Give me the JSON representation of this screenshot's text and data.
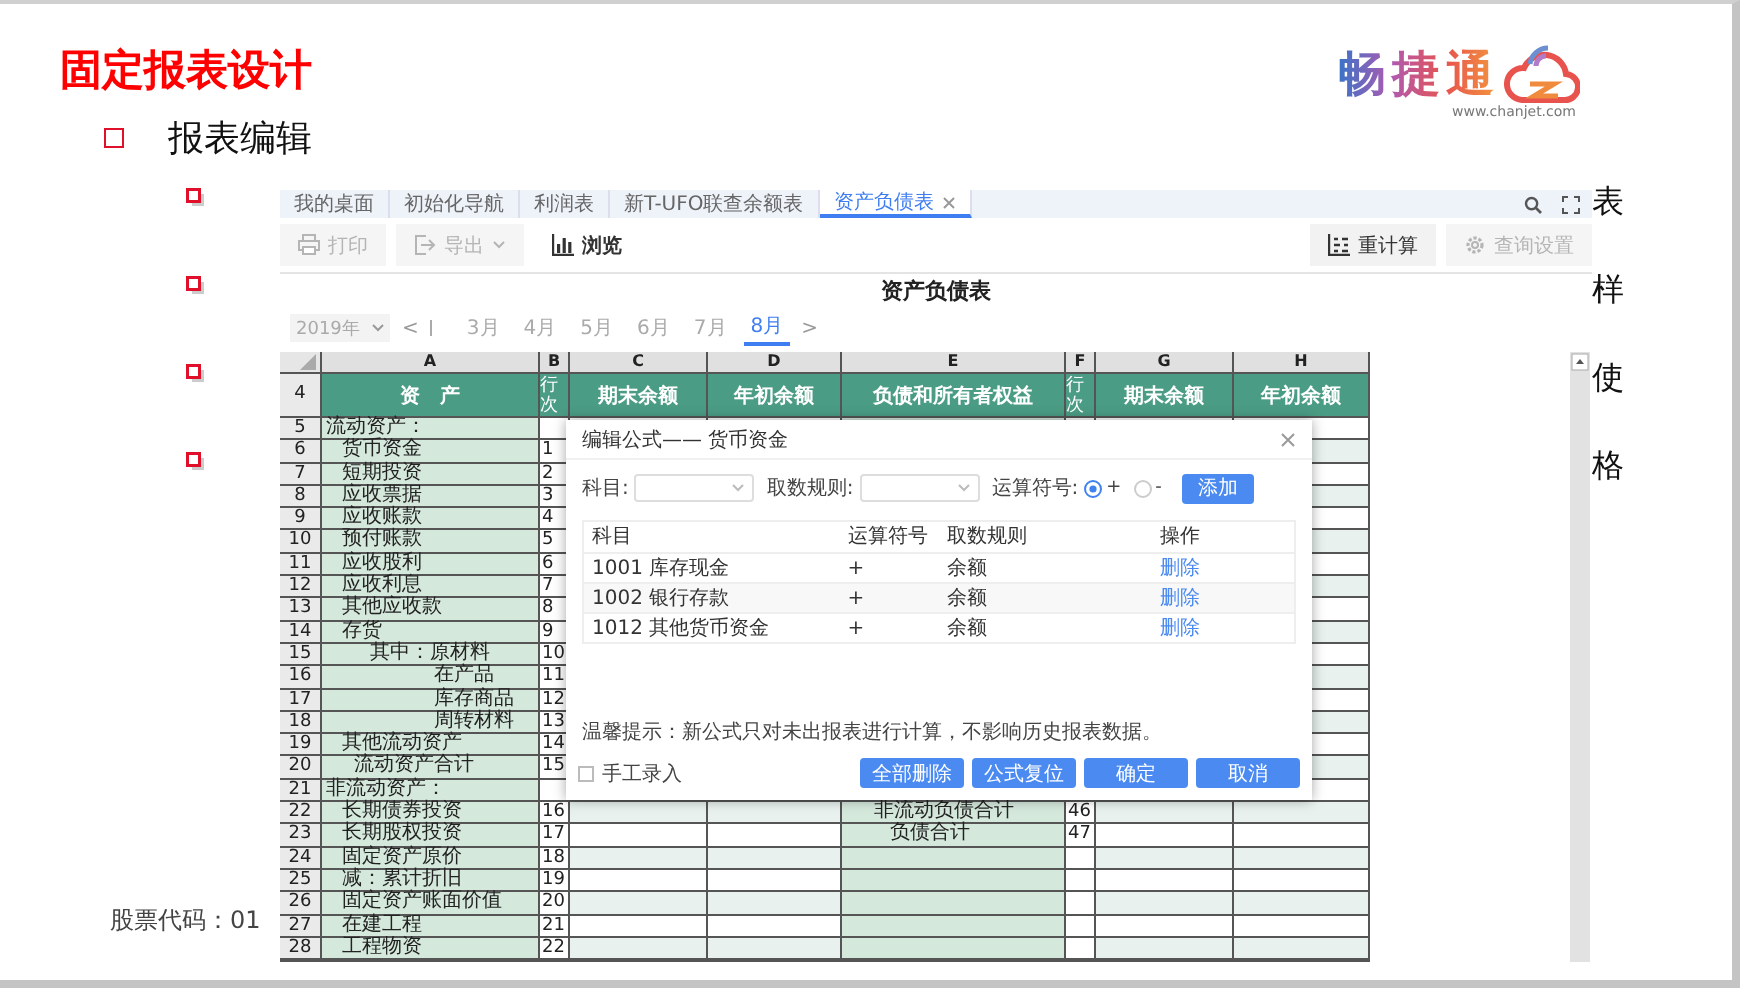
{
  "slide": {
    "title": "固定报表设计",
    "bullet": "报表编辑",
    "logo": {
      "name": "畅捷通",
      "url": "www.chanjet.com"
    },
    "side_fragments": [
      "表",
      "样",
      "使",
      "格"
    ],
    "footer": "股票代码：01"
  },
  "app": {
    "tabs": [
      {
        "label": "我的桌面",
        "selected": false
      },
      {
        "label": "初始化导航",
        "selected": false
      },
      {
        "label": "利润表",
        "selected": false
      },
      {
        "label": "新T-UFO联查余额表",
        "selected": false
      },
      {
        "label": "资产负债表",
        "selected": true
      }
    ],
    "toolbar_left": [
      {
        "label": "打印",
        "disabled": true
      },
      {
        "label": "导出",
        "disabled": true
      },
      {
        "label": "浏览",
        "disabled": false
      }
    ],
    "toolbar_right": [
      {
        "label": "重计算",
        "disabled": false
      },
      {
        "label": "查询设置",
        "disabled": true
      }
    ],
    "report_title": "资产负债表",
    "year": "2019年",
    "prev": "<",
    "next": ">",
    "months": [
      {
        "label": "3月",
        "selected": false
      },
      {
        "label": "4月",
        "selected": false
      },
      {
        "label": "5月",
        "selected": false
      },
      {
        "label": "6月",
        "selected": false
      },
      {
        "label": "7月",
        "selected": false
      },
      {
        "label": "8月",
        "selected": true
      }
    ],
    "sheet": {
      "columns": [
        "A",
        "B",
        "C",
        "D",
        "E",
        "F",
        "G",
        "H"
      ],
      "header": {
        "num": "4",
        "cells": [
          "资　产",
          "行次",
          "期末余额",
          "年初余额",
          "负债和所有者权益",
          "行次",
          "期末余额",
          "年初余额"
        ]
      },
      "rows": [
        {
          "num": "5",
          "asset": {
            "text": "流动资产：",
            "kind": "section"
          }
        },
        {
          "num": "6",
          "asset": {
            "text": "货币资金",
            "kind": "item"
          },
          "line": "1"
        },
        {
          "num": "7",
          "asset": {
            "text": "短期投资",
            "kind": "item"
          },
          "line": "2"
        },
        {
          "num": "8",
          "asset": {
            "text": "应收票据",
            "kind": "item"
          },
          "line": "3"
        },
        {
          "num": "9",
          "asset": {
            "text": "应收账款",
            "kind": "item"
          },
          "line": "4"
        },
        {
          "num": "10",
          "asset": {
            "text": "预付账款",
            "kind": "item"
          },
          "line": "5"
        },
        {
          "num": "11",
          "asset": {
            "text": "应收股利",
            "kind": "item"
          },
          "line": "6"
        },
        {
          "num": "12",
          "asset": {
            "text": "应收利息",
            "kind": "item"
          },
          "line": "7"
        },
        {
          "num": "13",
          "asset": {
            "text": "其他应收款",
            "kind": "item"
          },
          "line": "8"
        },
        {
          "num": "14",
          "asset": {
            "text": "存货",
            "kind": "item"
          },
          "line": "9"
        },
        {
          "num": "15",
          "asset": {
            "text": "其中：原材料",
            "kind": "sub"
          },
          "line": "10"
        },
        {
          "num": "16",
          "asset": {
            "text": "在产品",
            "kind": "detail"
          },
          "line": "11"
        },
        {
          "num": "17",
          "asset": {
            "text": "库存商品",
            "kind": "detail"
          },
          "line": "12"
        },
        {
          "num": "18",
          "asset": {
            "text": "周转材料",
            "kind": "detail"
          },
          "line": "13"
        },
        {
          "num": "19",
          "asset": {
            "text": "其他流动资产",
            "kind": "item"
          },
          "line": "14"
        },
        {
          "num": "20",
          "asset": {
            "text": "流动资产合计",
            "kind": "total"
          },
          "line": "15"
        },
        {
          "num": "21",
          "asset": {
            "text": "非流动资产：",
            "kind": "section"
          }
        },
        {
          "num": "22",
          "asset": {
            "text": "长期债券投资",
            "kind": "item"
          },
          "line": "16",
          "liability": {
            "text": "非流动负债合计",
            "kind": "total"
          },
          "liability_line": "46"
        },
        {
          "num": "23",
          "asset": {
            "text": "长期股权投资",
            "kind": "item"
          },
          "line": "17",
          "liability": {
            "text": "负债合计",
            "kind": "grand_total"
          },
          "liability_line": "47"
        },
        {
          "num": "24",
          "asset": {
            "text": "固定资产原价",
            "kind": "item"
          },
          "line": "18"
        },
        {
          "num": "25",
          "asset": {
            "text": "减：累计折旧",
            "kind": "item"
          },
          "line": "19"
        },
        {
          "num": "26",
          "asset": {
            "text": "固定资产账面价值",
            "kind": "item"
          },
          "line": "20"
        },
        {
          "num": "27",
          "asset": {
            "text": "在建工程",
            "kind": "item"
          },
          "line": "21"
        },
        {
          "num": "28",
          "asset": {
            "text": "工程物资",
            "kind": "item"
          },
          "line": "22"
        }
      ]
    },
    "dialog": {
      "title": "编辑公式—— 货币资金",
      "fields": [
        {
          "label": "科目:"
        },
        {
          "label": "取数规则:"
        }
      ],
      "operator": {
        "label": "运算符号:",
        "options": [
          {
            "label": "+",
            "selected": true
          },
          {
            "label": "-",
            "selected": false
          }
        ]
      },
      "add": "添加",
      "table": {
        "columns": [
          "科目",
          "运算符号",
          "取数规则",
          "操作"
        ],
        "rows": [
          {
            "account": "1001 库存现金",
            "op": "+",
            "rule": "余额",
            "action": "删除"
          },
          {
            "account": "1002 银行存款",
            "op": "+",
            "rule": "余额",
            "action": "删除"
          },
          {
            "account": "1012 其他货币资金",
            "op": "+",
            "rule": "余额",
            "action": "删除"
          }
        ]
      },
      "hint": "温馨提示：新公式只对未出报表进行计算，不影响历史报表数据。",
      "manual": {
        "label": "手工录入",
        "checked": false
      },
      "buttons": [
        "全部删除",
        "公式复位",
        "确定",
        "取消"
      ]
    }
  }
}
